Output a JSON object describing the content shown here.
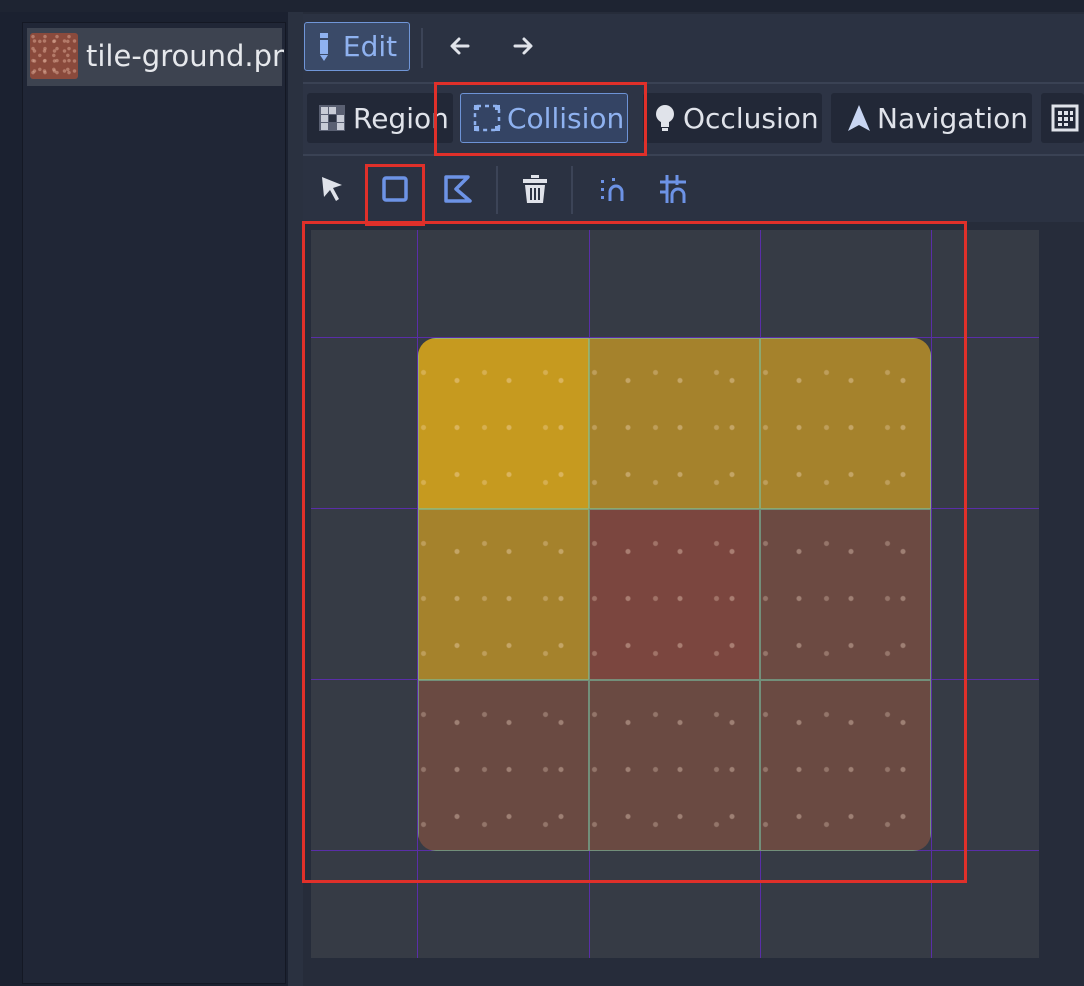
{
  "file_list": {
    "items": [
      {
        "name": "tile-ground.png",
        "selected": true
      }
    ]
  },
  "toolbar": {
    "edit_label": "Edit"
  },
  "tabs": [
    {
      "label": "Region",
      "active": false
    },
    {
      "label": "Collision",
      "active": true
    },
    {
      "label": "Occlusion",
      "active": false
    },
    {
      "label": "Navigation",
      "active": false
    }
  ],
  "tools": [
    "select-tool",
    "rectangle-tool",
    "polygon-tool",
    "delete-tool",
    "snap-tool",
    "grid-snap-tool"
  ],
  "tileset": {
    "grid": {
      "columns": 3,
      "rows": 3
    },
    "cells": [
      {
        "row": 0,
        "col": 0,
        "fill": "#c69a1f"
      },
      {
        "row": 0,
        "col": 1,
        "fill": "#a5822c"
      },
      {
        "row": 0,
        "col": 2,
        "fill": "#a5822c"
      },
      {
        "row": 1,
        "col": 0,
        "fill": "#a5822c"
      },
      {
        "row": 1,
        "col": 1,
        "fill": "#7b463f"
      },
      {
        "row": 1,
        "col": 2,
        "fill": "#6c4a42"
      },
      {
        "row": 2,
        "col": 0,
        "fill": "#6a4a42"
      },
      {
        "row": 2,
        "col": 1,
        "fill": "#6a4a42"
      },
      {
        "row": 2,
        "col": 2,
        "fill": "#6a4a42"
      }
    ]
  },
  "colors": {
    "accent": "#6d93d6",
    "highlight": "#e0302a",
    "grid": "#5a2ea8"
  }
}
